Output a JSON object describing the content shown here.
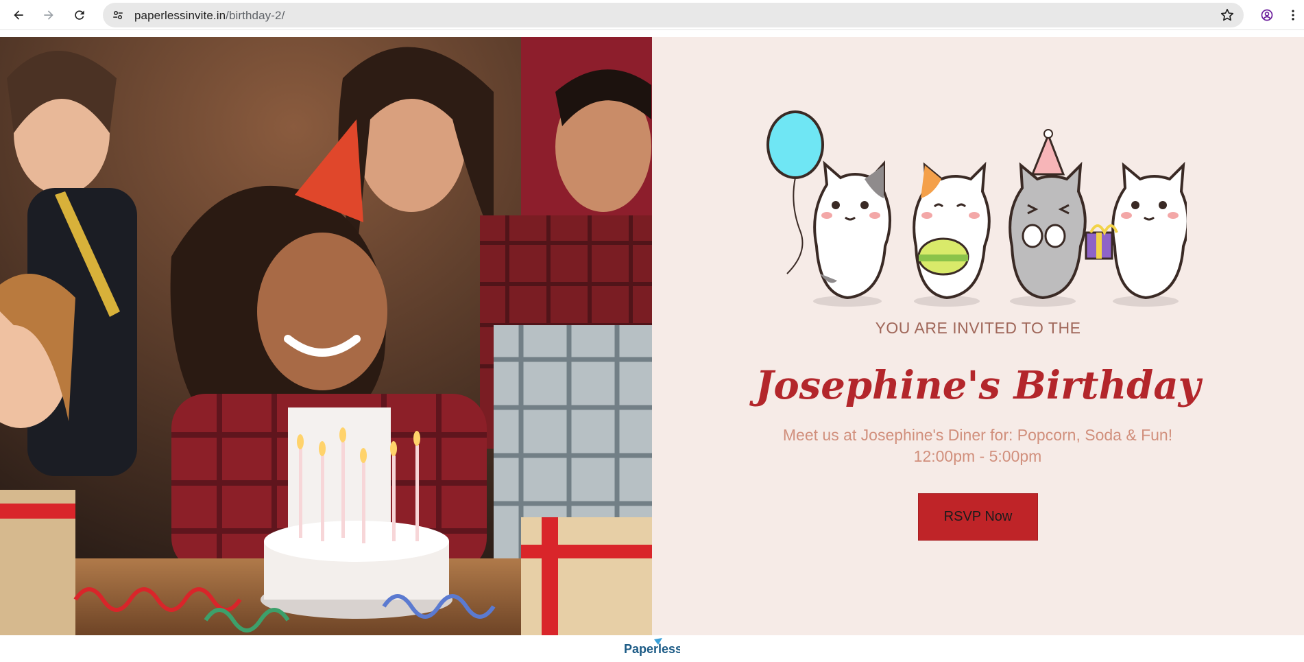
{
  "browser": {
    "url_host": "paperlessinvite.in",
    "url_path": "/birthday-2/",
    "icons": {
      "back": "arrow-left",
      "forward": "arrow-right",
      "reload": "reload",
      "site_info": "tune",
      "bookmark": "star",
      "profile": "account-circle",
      "menu": "more-vertical"
    }
  },
  "invitation": {
    "kicker": "YOU ARE INVITED TO THE",
    "title": "Josephine's Birthday",
    "details": "Meet us at Josephine's Diner for: Popcorn, Soda & Fun! 12:00pm - 5:00pm",
    "rsvp_label": "RSVP Now",
    "colors": {
      "panel_bg": "#f6ebe7",
      "title": "#b3262b",
      "kicker": "#a0675a",
      "details": "#d18f7c",
      "button": "#bf2428"
    }
  },
  "footer": {
    "logo_text": "Paperless"
  }
}
